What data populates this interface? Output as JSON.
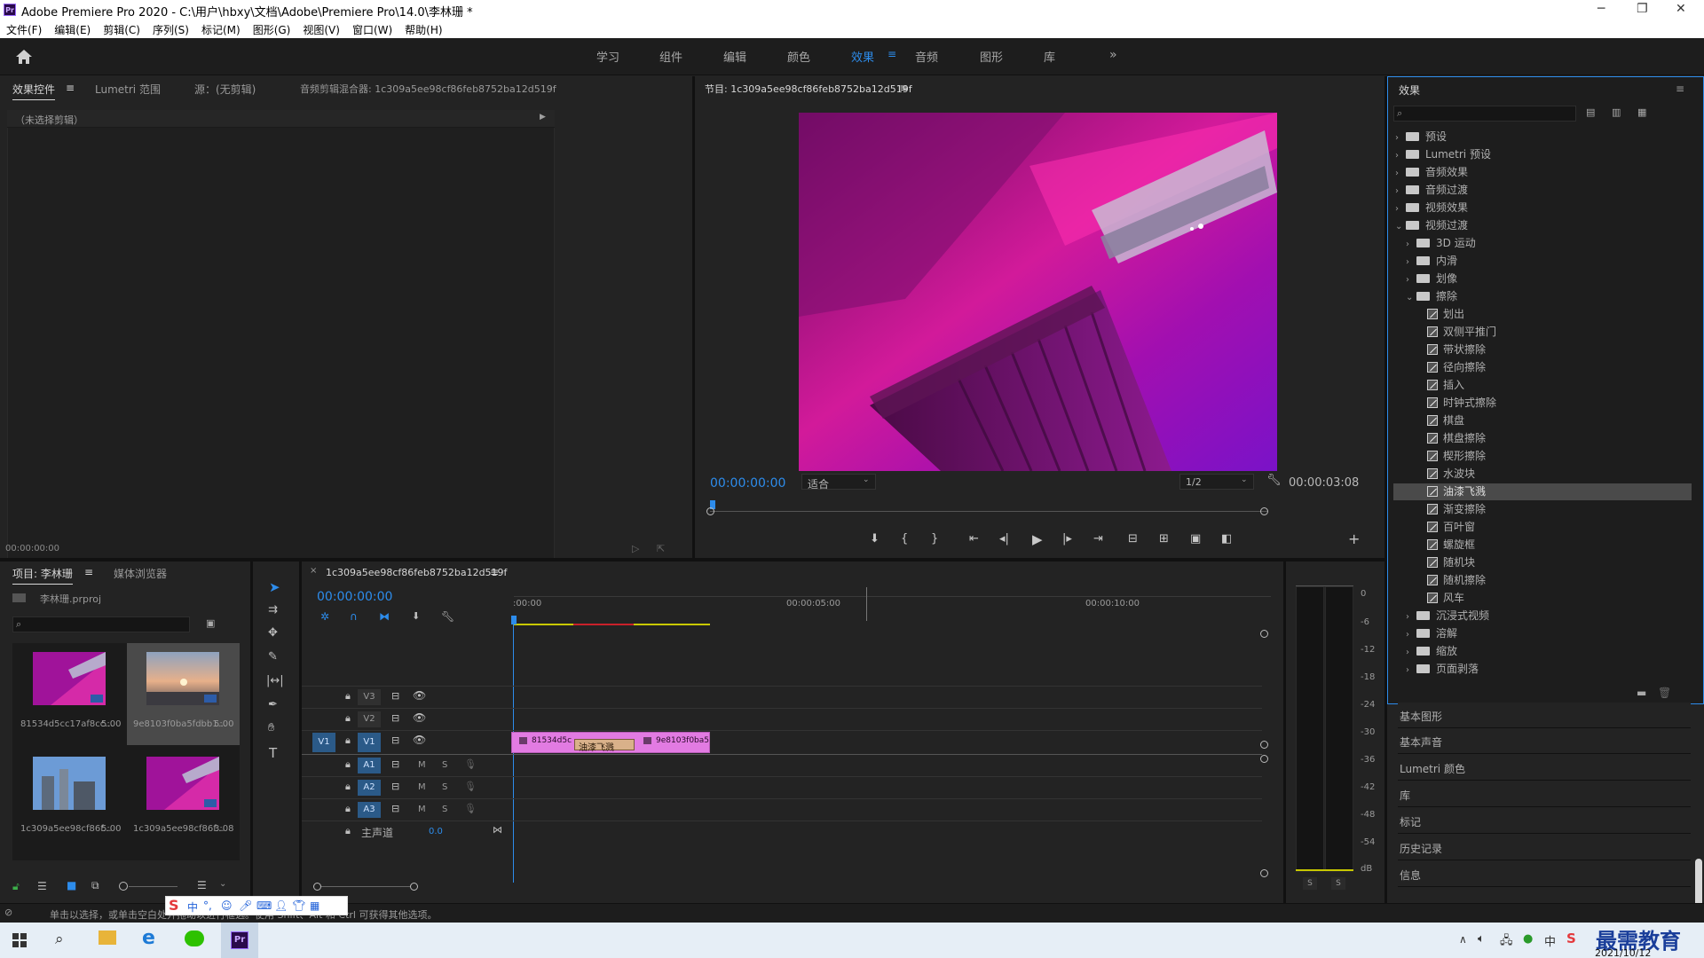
{
  "app": {
    "title": "Adobe Premiere Pro 2020 - C:\\用户\\hbxy\\文档\\Adobe\\Premiere Pro\\14.0\\李林珊 *",
    "icon_label": "Pr"
  },
  "menu": [
    "文件(F)",
    "编辑(E)",
    "剪辑(C)",
    "序列(S)",
    "标记(M)",
    "图形(G)",
    "视图(V)",
    "窗口(W)",
    "帮助(H)"
  ],
  "workspaces": [
    "学习",
    "组件",
    "编辑",
    "颜色",
    "效果",
    "音频",
    "图形",
    "库"
  ],
  "active_workspace": "效果",
  "source_panel": {
    "tabs": [
      "效果控件",
      "Lumetri 范围",
      "源：(无剪辑)",
      "音频剪辑混合器: 1c309a5ee98cf86feb8752ba12d519f"
    ],
    "no_clip": "（未选择剪辑）",
    "timecode": "00:00:00:00"
  },
  "program_monitor": {
    "title": "节目: 1c309a5ee98cf86feb8752ba12d519f",
    "timecode": "00:00:00:00",
    "fit": "适合",
    "resolution": "1/2",
    "duration": "00:00:03:08"
  },
  "effects_panel": {
    "title": "效果",
    "tree": [
      {
        "label": "预设",
        "level": 0,
        "type": "folder",
        "open": false
      },
      {
        "label": "Lumetri 预设",
        "level": 0,
        "type": "folder",
        "open": false
      },
      {
        "label": "音频效果",
        "level": 0,
        "type": "folder",
        "open": false
      },
      {
        "label": "音频过渡",
        "level": 0,
        "type": "folder",
        "open": false
      },
      {
        "label": "视频效果",
        "level": 0,
        "type": "folder",
        "open": false
      },
      {
        "label": "视频过渡",
        "level": 0,
        "type": "folder",
        "open": true
      },
      {
        "label": "3D 运动",
        "level": 1,
        "type": "folder",
        "open": false
      },
      {
        "label": "内滑",
        "level": 1,
        "type": "folder",
        "open": false
      },
      {
        "label": "划像",
        "level": 1,
        "type": "folder",
        "open": false
      },
      {
        "label": "擦除",
        "level": 1,
        "type": "folder",
        "open": true
      },
      {
        "label": "划出",
        "level": 2,
        "type": "fx"
      },
      {
        "label": "双侧平推门",
        "level": 2,
        "type": "fx"
      },
      {
        "label": "带状擦除",
        "level": 2,
        "type": "fx"
      },
      {
        "label": "径向擦除",
        "level": 2,
        "type": "fx"
      },
      {
        "label": "插入",
        "level": 2,
        "type": "fx"
      },
      {
        "label": "时钟式擦除",
        "level": 2,
        "type": "fx"
      },
      {
        "label": "棋盘",
        "level": 2,
        "type": "fx"
      },
      {
        "label": "棋盘擦除",
        "level": 2,
        "type": "fx"
      },
      {
        "label": "楔形擦除",
        "level": 2,
        "type": "fx"
      },
      {
        "label": "水波块",
        "level": 2,
        "type": "fx"
      },
      {
        "label": "油漆飞溅",
        "level": 2,
        "type": "fx",
        "selected": true
      },
      {
        "label": "渐变擦除",
        "level": 2,
        "type": "fx"
      },
      {
        "label": "百叶窗",
        "level": 2,
        "type": "fx"
      },
      {
        "label": "螺旋框",
        "level": 2,
        "type": "fx"
      },
      {
        "label": "随机块",
        "level": 2,
        "type": "fx"
      },
      {
        "label": "随机擦除",
        "level": 2,
        "type": "fx"
      },
      {
        "label": "风车",
        "level": 2,
        "type": "fx"
      },
      {
        "label": "沉浸式视频",
        "level": 1,
        "type": "folder",
        "open": false
      },
      {
        "label": "溶解",
        "level": 1,
        "type": "folder",
        "open": false
      },
      {
        "label": "缩放",
        "level": 1,
        "type": "folder",
        "open": false
      },
      {
        "label": "页面剥落",
        "level": 1,
        "type": "folder",
        "open": false
      }
    ]
  },
  "collapsed_panels": [
    "基本图形",
    "基本声音",
    "Lumetri 颜色",
    "库",
    "标记",
    "历史记录",
    "信息"
  ],
  "project_panel": {
    "tabs": [
      "项目: 李林珊",
      "媒体浏览器"
    ],
    "project_file": "李林珊.prproj",
    "items": [
      {
        "name": "81534d5cc17af8cc...",
        "duration": "5:00",
        "color": "magenta",
        "selected": false
      },
      {
        "name": "9e8103f0ba5fdbb1...",
        "duration": "5:00",
        "color": "sunset",
        "selected": true
      },
      {
        "name": "1c309a5ee98cf86f...",
        "duration": "5:00",
        "color": "sky",
        "selected": false
      },
      {
        "name": "1c309a5ee98cf86f...",
        "duration": "3:08",
        "color": "magenta",
        "selected": false
      }
    ]
  },
  "timeline": {
    "sequence_name": "1c309a5ee98cf86feb8752ba12d519f",
    "timecode": "00:00:00:00",
    "ruler": [
      ":00:00",
      "00:00:05:00",
      "00:00:10:00"
    ],
    "video_tracks": [
      "V3",
      "V2",
      "V1"
    ],
    "audio_tracks": [
      "A1",
      "A2",
      "A3"
    ],
    "source_patch": "V1",
    "master_label": "主声道",
    "master_value": "0.0",
    "clips": [
      {
        "label": "81534d5c",
        "track": "V1"
      },
      {
        "label": "油漆飞溅",
        "track": "V1",
        "kind": "transition"
      },
      {
        "label": "9e8103f0ba5",
        "track": "V1"
      }
    ]
  },
  "meter": {
    "scale": [
      "0",
      "-6",
      "-12",
      "-18",
      "-24",
      "-30",
      "-36",
      "-42",
      "-48",
      "-54",
      "dB"
    ],
    "solo": [
      "S",
      "S"
    ]
  },
  "status": {
    "text": "单击以选择，或单击空白处并拖动以进行框选。使用 Shift、Alt 和 Ctrl 可获得其他选项。"
  },
  "taskbar": {
    "date": "2021/10/12",
    "watermark": "最需教育"
  }
}
